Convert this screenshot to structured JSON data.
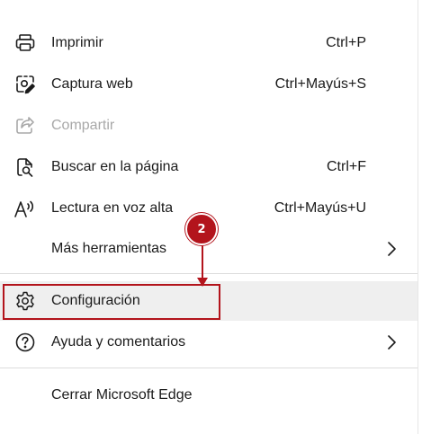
{
  "accent_color": "#b3141c",
  "menu": {
    "items": [
      {
        "icon": "printer-icon",
        "label": "Imprimir",
        "shortcut": "Ctrl+P"
      },
      {
        "icon": "web-capture-icon",
        "label": "Captura web",
        "shortcut": "Ctrl+Mayús+S"
      },
      {
        "icon": "share-icon",
        "label": "Compartir",
        "shortcut": "",
        "disabled": true
      },
      {
        "icon": "find-in-page-icon",
        "label": "Buscar en la página",
        "shortcut": "Ctrl+F"
      },
      {
        "icon": "read-aloud-icon",
        "label": "Lectura en voz alta",
        "shortcut": "Ctrl+Mayús+U"
      },
      {
        "icon": "",
        "label": "Más herramientas",
        "shortcut": "",
        "submenu": true
      },
      {
        "icon": "gear-icon",
        "label": "Configuración",
        "shortcut": "",
        "highlighted": true
      },
      {
        "icon": "help-icon",
        "label": "Ayuda y comentarios",
        "shortcut": "",
        "submenu": true
      },
      {
        "icon": "",
        "label": "Cerrar Microsoft Edge",
        "shortcut": ""
      }
    ]
  },
  "annotation": {
    "step_number": "2",
    "target": "Configuración"
  }
}
